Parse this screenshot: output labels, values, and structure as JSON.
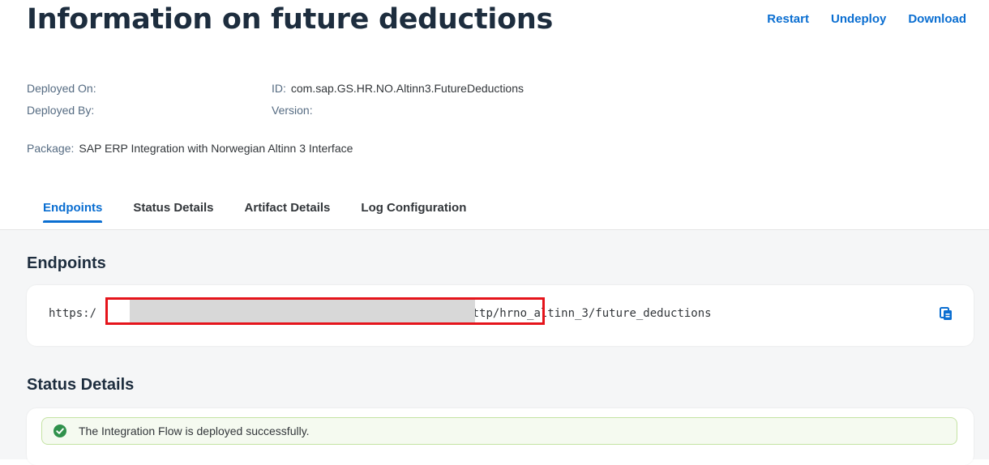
{
  "page": {
    "title": "Information on future deductions"
  },
  "actions": {
    "restart": "Restart",
    "undeploy": "Undeploy",
    "download": "Download"
  },
  "meta": {
    "deployed_on_label": "Deployed On:",
    "deployed_by_label": "Deployed By:",
    "id_label": "ID:",
    "id_value": "com.sap.GS.HR.NO.Altinn3.FutureDeductions",
    "version_label": "Version:",
    "package_label": "Package:",
    "package_value": "SAP ERP Integration with Norwegian Altinn 3 Interface"
  },
  "tabs": [
    {
      "label": "Endpoints",
      "active": true
    },
    {
      "label": "Status Details",
      "active": false
    },
    {
      "label": "Artifact Details",
      "active": false
    },
    {
      "label": "Log Configuration",
      "active": false
    }
  ],
  "endpoints": {
    "title": "Endpoints",
    "url": "https:/                                        .ondemand.com/http/hrno_altinn_3/future_deductions",
    "copy_icon": "copy-icon"
  },
  "status": {
    "title": "Status Details",
    "message": "The Integration Flow is deployed successfully.",
    "icon": "success-check-icon"
  },
  "colors": {
    "accent": "#0a6ed1",
    "success": "#30914c",
    "highlight": "#e5141b"
  }
}
